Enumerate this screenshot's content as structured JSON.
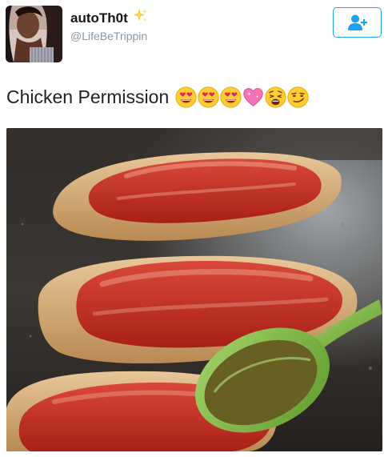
{
  "tweet": {
    "user": {
      "display_name": "autoTh0t",
      "handle": "@LifeBeTrippin"
    },
    "text": "Chicken Permission",
    "emojis": [
      "heart-eyes-emoji",
      "heart-eyes-emoji",
      "heart-eyes-emoji",
      "sparkling-heart-emoji",
      "weary-face-emoji",
      "smirking-face-emoji"
    ]
  },
  "colors": {
    "follow_blue": "#1da1f2",
    "handle_gray": "#8899a6",
    "sauce_red": "#c22a1f",
    "spoon_green": "#7cb342"
  }
}
